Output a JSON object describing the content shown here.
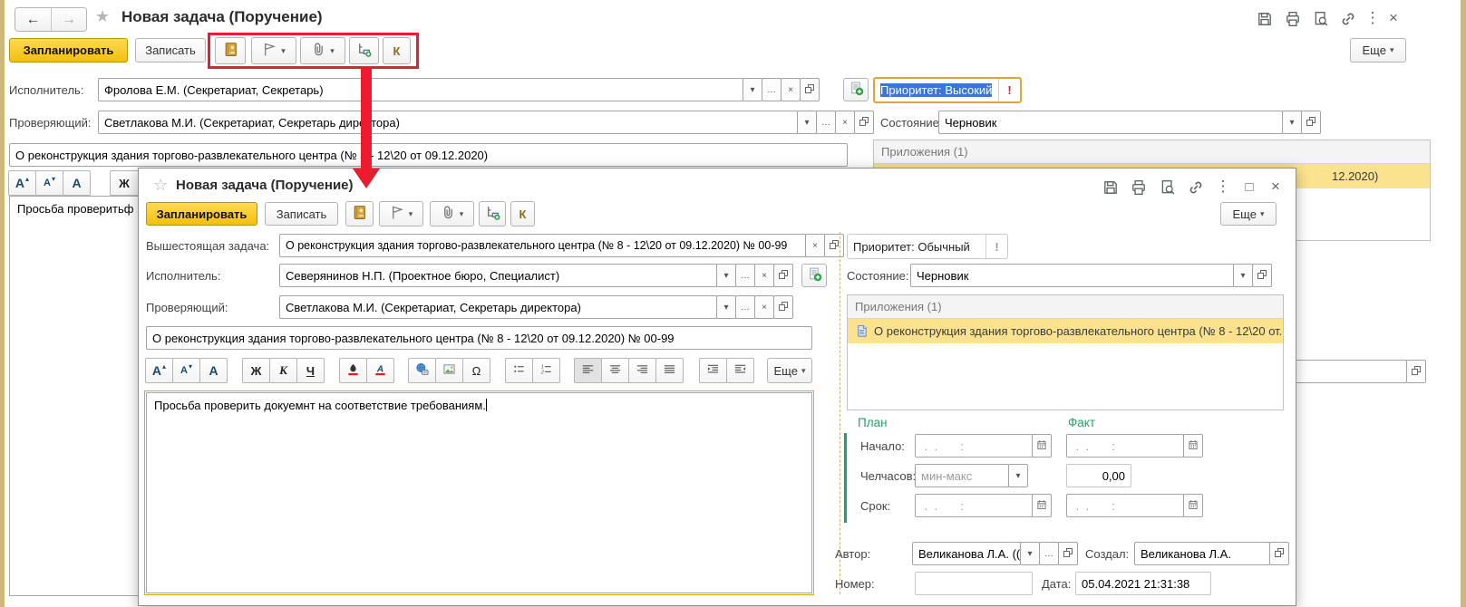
{
  "colors": {
    "accent_yellow_button": "#f2bf10",
    "annotation_red": "#ec1c2e",
    "selection_blue": "#3a77d4",
    "attachment_highlight": "#fbe28f",
    "plan_fact_green": "#27a066",
    "priority_focus_border": "#e1a43b"
  },
  "outer": {
    "title": "Новая задача (Поручение)",
    "toolbar": {
      "schedule": "Запланировать",
      "save": "Записать",
      "k": "К",
      "more": "Еще"
    },
    "executor_label": "Исполнитель:",
    "executor_value": "Фролова Е.М. (Секретариат, Секретарь)",
    "reviewer_label": "Проверяющий:",
    "reviewer_value": "Светлакова М.И. (Секретариат, Секретарь директора)",
    "subject_value": "О реконструкция здания торгово-развлекательного центра (№ 8 - 12\\20 от 09.12.2020)",
    "priority_value": "Приоритет: Высокий",
    "state_label": "Состояние:",
    "state_value": "Черновик",
    "attachments_header": "Приложения (1)",
    "attachment_visible_fragment": "12.2020)",
    "description_visible_fragment": "Просьба проверитьф",
    "format": {
      "a": "А",
      "bold": "Ж"
    }
  },
  "dialog": {
    "title": "Новая задача (Поручение)",
    "toolbar": {
      "schedule": "Запланировать",
      "save": "Записать",
      "k": "К",
      "more": "Еще"
    },
    "parent_label": "Вышестоящая задача:",
    "parent_value": "О реконструкция здания торгово-развлекательного центра (№ 8 - 12\\20 от 09.12.2020) № 00-99",
    "executor_label": "Исполнитель:",
    "executor_value": "Северянинов Н.П. (Проектное бюро, Специалист)",
    "reviewer_label": "Проверяющий:",
    "reviewer_value": "Светлакова М.И. (Секретариат, Секретарь директора)",
    "subject_value": "О реконструкция здания торгово-развлекательного центра (№ 8 - 12\\20 от 09.12.2020) № 00-99",
    "description": "Просьба проверить докуемнт на соответствие требованиям.",
    "format": {
      "a": "А",
      "bold": "Ж",
      "italic": "К",
      "underline": "Ч",
      "omega": "Ω",
      "more": "Еще"
    },
    "priority_value": "Приоритет: Обычный",
    "state_label": "Состояние:",
    "state_value": "Черновик",
    "attachments_header": "Приложения (1)",
    "attachment_item": "О реконструкция здания торгово-развлекательного центра (№ 8 - 12\\20 от...",
    "plan": {
      "plan_header": "План",
      "fact_header": "Факт",
      "start_label": "Начало:",
      "hours_label": "Челчасов:",
      "due_label": "Срок:",
      "date_placeholder": " .  .       :",
      "hours_placeholder": "мин-макс",
      "fact_hours": "0,00"
    },
    "footer": {
      "author_label": "Автор:",
      "author_value": "Великанова Л.А. ((",
      "created_label": "Создал:",
      "created_value": "Великанова Л.А.",
      "number_label": "Номер:",
      "number_value": "",
      "date_label": "Дата:",
      "date_value": "05.04.2021 21:31:38"
    }
  }
}
